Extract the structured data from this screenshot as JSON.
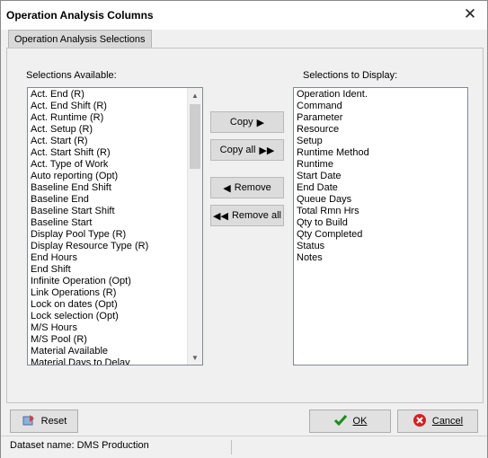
{
  "window": {
    "title": "Operation Analysis Columns"
  },
  "tab": {
    "label": "Operation Analysis Selections"
  },
  "available": {
    "label": "Selections Available:",
    "items": [
      "Act. End (R)",
      "Act. End Shift (R)",
      "Act. Runtime (R)",
      "Act. Setup (R)",
      "Act. Start (R)",
      "Act. Start Shift (R)",
      "Act. Type of Work",
      "Auto reporting (Opt)",
      "Baseline End Shift",
      "Baseline End",
      "Baseline Start Shift",
      "Baseline Start",
      "Display Pool Type (R)",
      "Display Resource Type (R)",
      "End Hours",
      "End Shift",
      "Infinite Operation (Opt)",
      "Link Operations (R)",
      "Lock on dates (Opt)",
      "Lock selection (Opt)",
      "M/S Hours",
      "M/S Pool (R)",
      "Material Available",
      "Material Days to Delay"
    ]
  },
  "display": {
    "label": "Selections to Display:",
    "items": [
      "Operation Ident.",
      "Command",
      "Parameter",
      "Resource",
      "Setup",
      "Runtime Method",
      "Runtime",
      "Start Date",
      "End Date",
      "Queue Days",
      "Total Rmn Hrs",
      "Qty to Build",
      "Qty Completed",
      "Status",
      "Notes"
    ]
  },
  "buttons": {
    "copy": "Copy",
    "copy_all": "Copy all",
    "remove": "Remove",
    "remove_all": "Remove all",
    "reset": "Reset",
    "ok": "OK",
    "cancel": "Cancel"
  },
  "status": {
    "dataset": "Dataset name:  DMS Production"
  },
  "icons": {
    "copy": "arrow-right-icon",
    "copy_all": "double-arrow-right-icon",
    "remove": "arrow-left-icon",
    "remove_all": "double-arrow-left-icon",
    "reset": "reset-icon",
    "ok": "checkmark-icon",
    "cancel": "cancel-icon",
    "close": "close-icon"
  },
  "colors": {
    "ok_check": "#1a8c1a",
    "cancel_red": "#d42020"
  }
}
